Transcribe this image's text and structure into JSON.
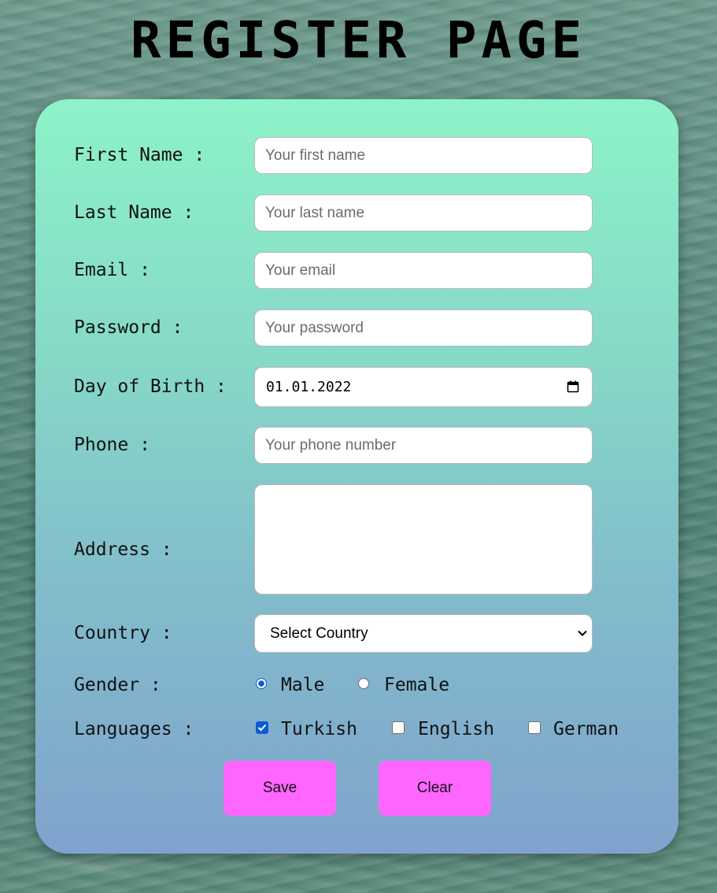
{
  "page": {
    "title": "REGISTER PAGE"
  },
  "form": {
    "first_name": {
      "label": "First Name :",
      "placeholder": "Your first name"
    },
    "last_name": {
      "label": "Last Name :",
      "placeholder": "Your last name"
    },
    "email": {
      "label": "Email :",
      "placeholder": "Your email"
    },
    "password": {
      "label": "Password :",
      "placeholder": "Your password"
    },
    "birth": {
      "label": "Day of Birth :",
      "value": "01.01.2022",
      "icon": "calendar-icon"
    },
    "phone": {
      "label": "Phone :",
      "placeholder": "Your phone number"
    },
    "address": {
      "label": "Address :",
      "value": ""
    },
    "country": {
      "label": "Country :",
      "selected": "Select Country",
      "icon": "chevron-down-icon"
    },
    "gender": {
      "label": "Gender :",
      "options": [
        {
          "label": "Male",
          "checked": true
        },
        {
          "label": "Female",
          "checked": false
        }
      ]
    },
    "languages": {
      "label": "Languages :",
      "options": [
        {
          "label": "Turkish",
          "checked": true
        },
        {
          "label": "English",
          "checked": false
        },
        {
          "label": "German",
          "checked": false
        }
      ]
    }
  },
  "buttons": {
    "save_label": "Save",
    "clear_label": "Clear"
  },
  "colors": {
    "card_top": "#8df3c9",
    "card_bottom": "#7fa3cd",
    "button_bg": "#ff66ff",
    "accent": "#0b5bd6"
  }
}
